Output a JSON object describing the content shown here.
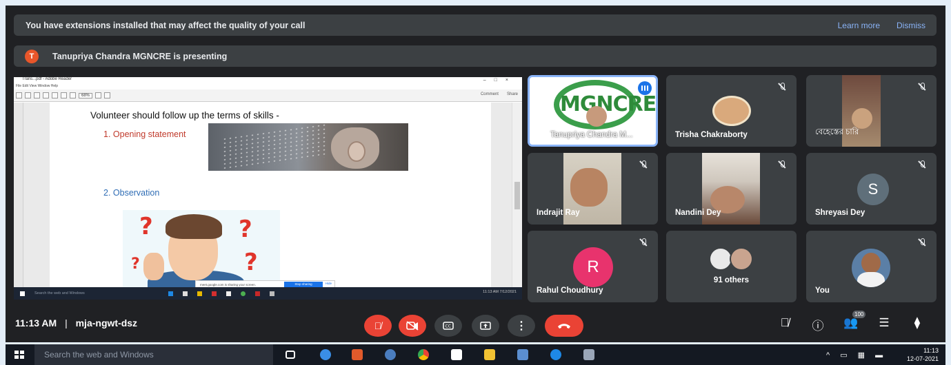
{
  "notice": {
    "text": "You have extensions installed that may affect the quality of your call",
    "learn_more": "Learn more",
    "dismiss": "Dismiss"
  },
  "presenting": {
    "initial": "T",
    "text": "Tanupriya Chandra MGNCRE is presenting"
  },
  "shared_screen": {
    "reader_title": "Trans...pdf - Adobe Reader",
    "reader_menu": "File  Edit  View  Window  Help",
    "zoom": "68%",
    "comment_label": "Comment",
    "share_label": "Share",
    "slide_title": "Volunteer should follow up the terms of skills -",
    "item1": "1.  Opening statement",
    "item2": "2.  Observation",
    "sharing_notice": "meet.google.com is sharing your screen.",
    "stop_sharing": "Stop sharing",
    "hide": "Hide",
    "search_text": "Search the web and Windows",
    "clock": "11:13 AM 7/12/2021"
  },
  "participants": [
    {
      "name": "Tanupriya Chandra M...",
      "logo_text": "MGNCRE"
    },
    {
      "name": "Trisha Chakraborty"
    },
    {
      "name": "বেহেস্তের চারি"
    },
    {
      "name": "Indrajit Ray"
    },
    {
      "name": "Nandini Dey"
    },
    {
      "name": "Shreyasi Dey",
      "initial": "S"
    },
    {
      "name": "Rahul Choudhury",
      "initial": "R"
    },
    {
      "name": "91 others"
    },
    {
      "name": "You"
    }
  ],
  "colors": {
    "shreyasi_avatar": "#5f6f7a",
    "rahul_avatar": "#e8336d",
    "end_call": "#ea4335"
  },
  "bottom_bar": {
    "time": "11:13 AM",
    "separator": "|",
    "meeting_code": "mja-ngwt-dsz",
    "participant_count": "100"
  },
  "windows_taskbar": {
    "search": "Search the web and Windows",
    "time": "11:13",
    "date": "12-07-2021"
  }
}
